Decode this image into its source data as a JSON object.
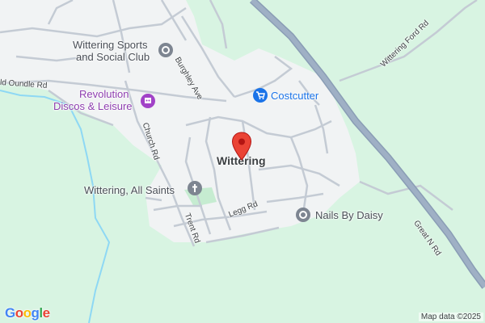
{
  "map": {
    "place_label": "Wittering",
    "road_labels": {
      "old_oundle": "ld Oundle Rd",
      "burghley": "Burghley Ave",
      "church": "Church Rd",
      "trent": "Trent Rd",
      "legg": "Legg Rd",
      "wittering_ford": "Wittering Ford Rd",
      "great_north": "Great N Rd"
    },
    "pois": {
      "sports_club": {
        "line1": "Wittering Sports",
        "line2": "and Social Club",
        "icon": "generic-poi-icon"
      },
      "revolution": {
        "line1": "Revolution",
        "line2": "Discos & Leisure",
        "icon": "entertainment-icon",
        "color": "#8f3fb0"
      },
      "costcutter": {
        "label": "Costcutter",
        "icon": "shopping-cart-icon",
        "color": "#1a73e8"
      },
      "all_saints": {
        "label": "Wittering, All Saints",
        "icon": "church-cross-icon"
      },
      "nails": {
        "label": "Nails By Daisy",
        "icon": "generic-poi-icon"
      }
    },
    "pin_icon": "map-pin-icon",
    "colors": {
      "land": "#d8f4e2",
      "urban": "#f1f3f4",
      "road_outline": "#c4cbd4",
      "highway": "#8a9db5",
      "water": "#8ed8f4",
      "pin": "#ea4335"
    }
  },
  "footer": {
    "logo": [
      "G",
      "o",
      "o",
      "g",
      "l",
      "e"
    ],
    "logo_colors": [
      "#4285f4",
      "#ea4335",
      "#fbbc05",
      "#4285f4",
      "#34a853",
      "#ea4335"
    ],
    "attribution": "Map data ©2025"
  }
}
